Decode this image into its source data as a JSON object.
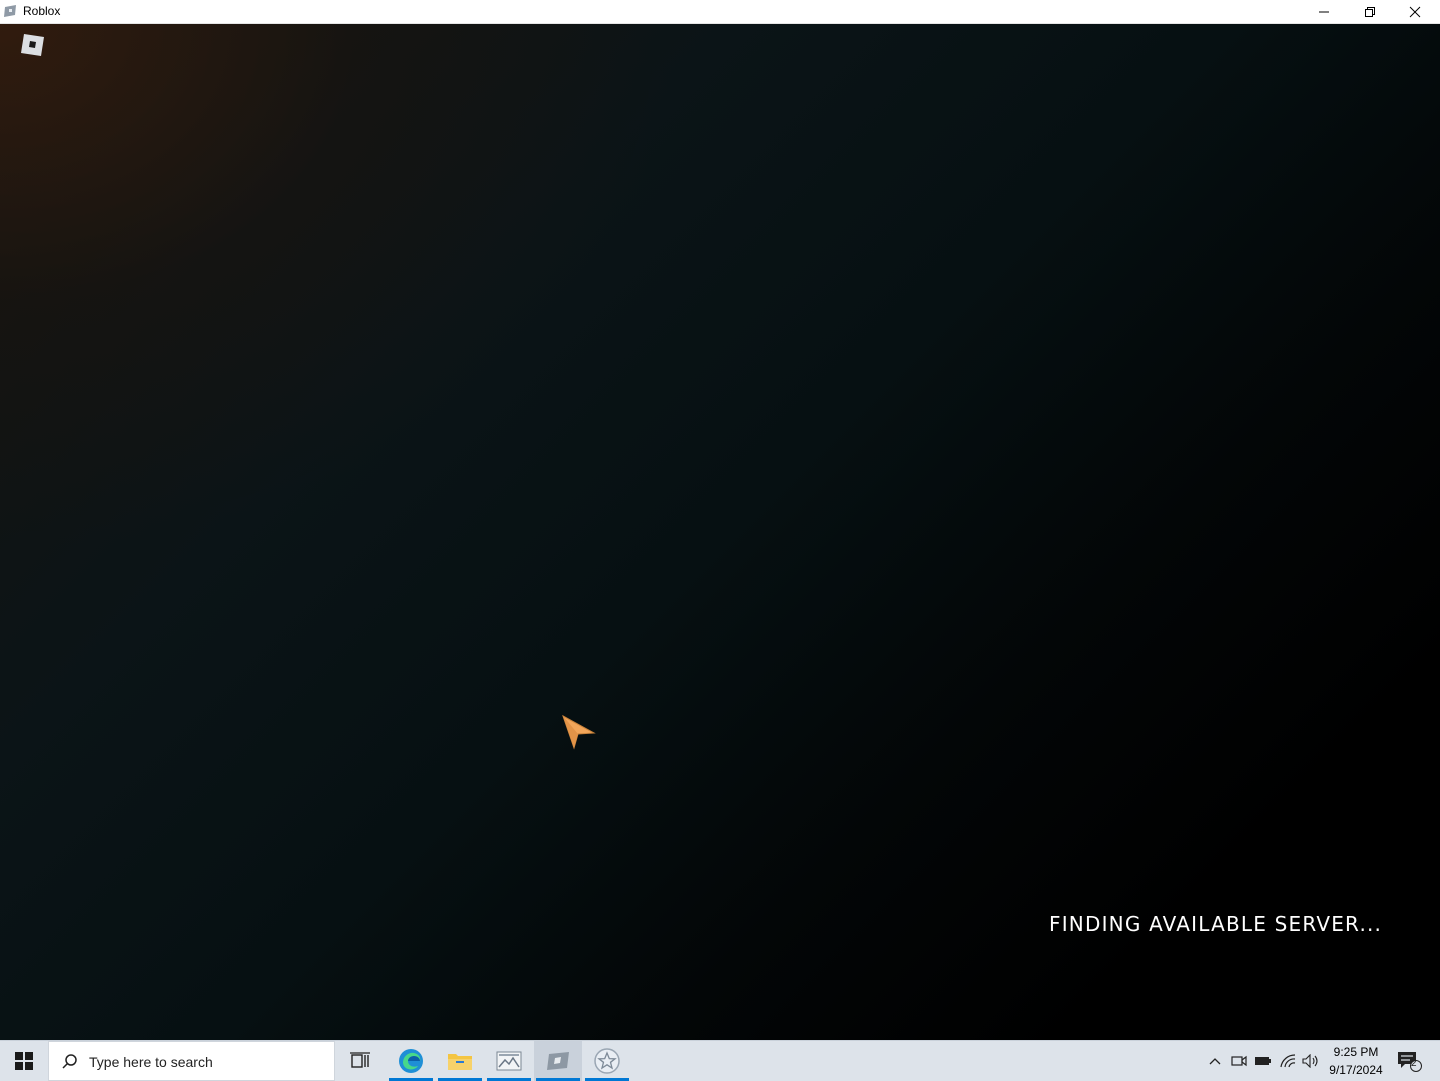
{
  "window": {
    "title": "Roblox",
    "controls": [
      "minimize",
      "restore",
      "close"
    ]
  },
  "game": {
    "status_text": "FINDING AVAILABLE SERVER...",
    "logo": "roblox-logo-icon"
  },
  "taskbar": {
    "search_placeholder": "Type here to search",
    "apps": [
      {
        "name": "task-view-icon"
      },
      {
        "name": "edge-icon"
      },
      {
        "name": "file-explorer-icon"
      },
      {
        "name": "photos-icon"
      },
      {
        "name": "roblox-icon"
      },
      {
        "name": "star-app-icon"
      }
    ],
    "clock": {
      "time": "9:25 PM",
      "date": "9/17/2024"
    },
    "notifications": "2"
  },
  "colors": {
    "accent": "#0078d4",
    "cursor": "#f2a65a"
  }
}
